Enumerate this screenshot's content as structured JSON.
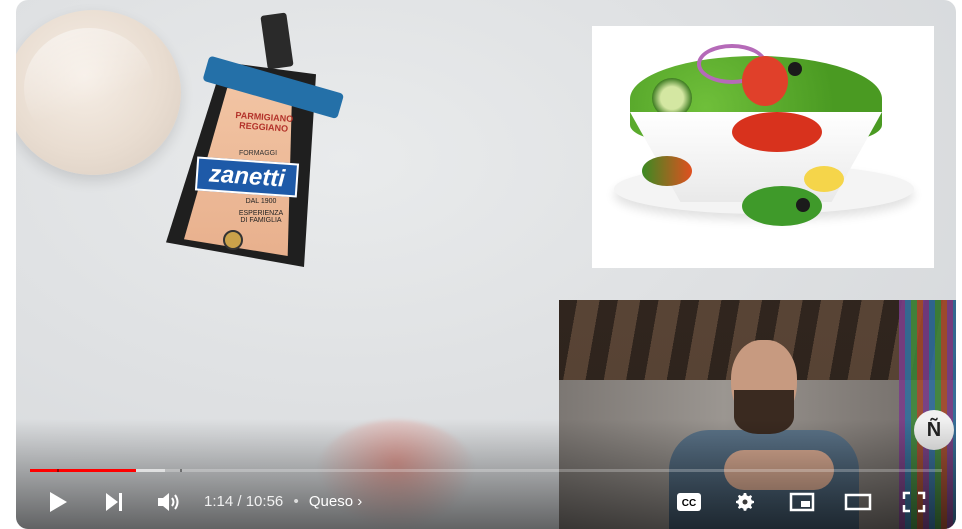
{
  "product": {
    "package_text": "PARMIGIANO REGGIANO",
    "sub_text": "FORMAGGI",
    "brand": "zanetti",
    "since": "DAL 1900",
    "tagline": "ESPERIENZA DI FAMIGLIA"
  },
  "player": {
    "current_time": "1:14",
    "duration": "10:56",
    "time_separator": " / ",
    "dot": "•",
    "chapter": "Queso",
    "progress_played_fraction": 0.116,
    "progress_loaded_fraction": 0.148,
    "chapter_markers": [
      0.03,
      0.165
    ],
    "accent_color": "#ff0000"
  },
  "webcam": {
    "badge_text": "Ñ"
  },
  "controls": {
    "left": [
      "play-icon",
      "next-icon",
      "volume-icon"
    ],
    "right": [
      "subtitles-icon",
      "settings-icon",
      "miniplayer-icon",
      "theater-icon",
      "fullscreen-icon"
    ]
  }
}
